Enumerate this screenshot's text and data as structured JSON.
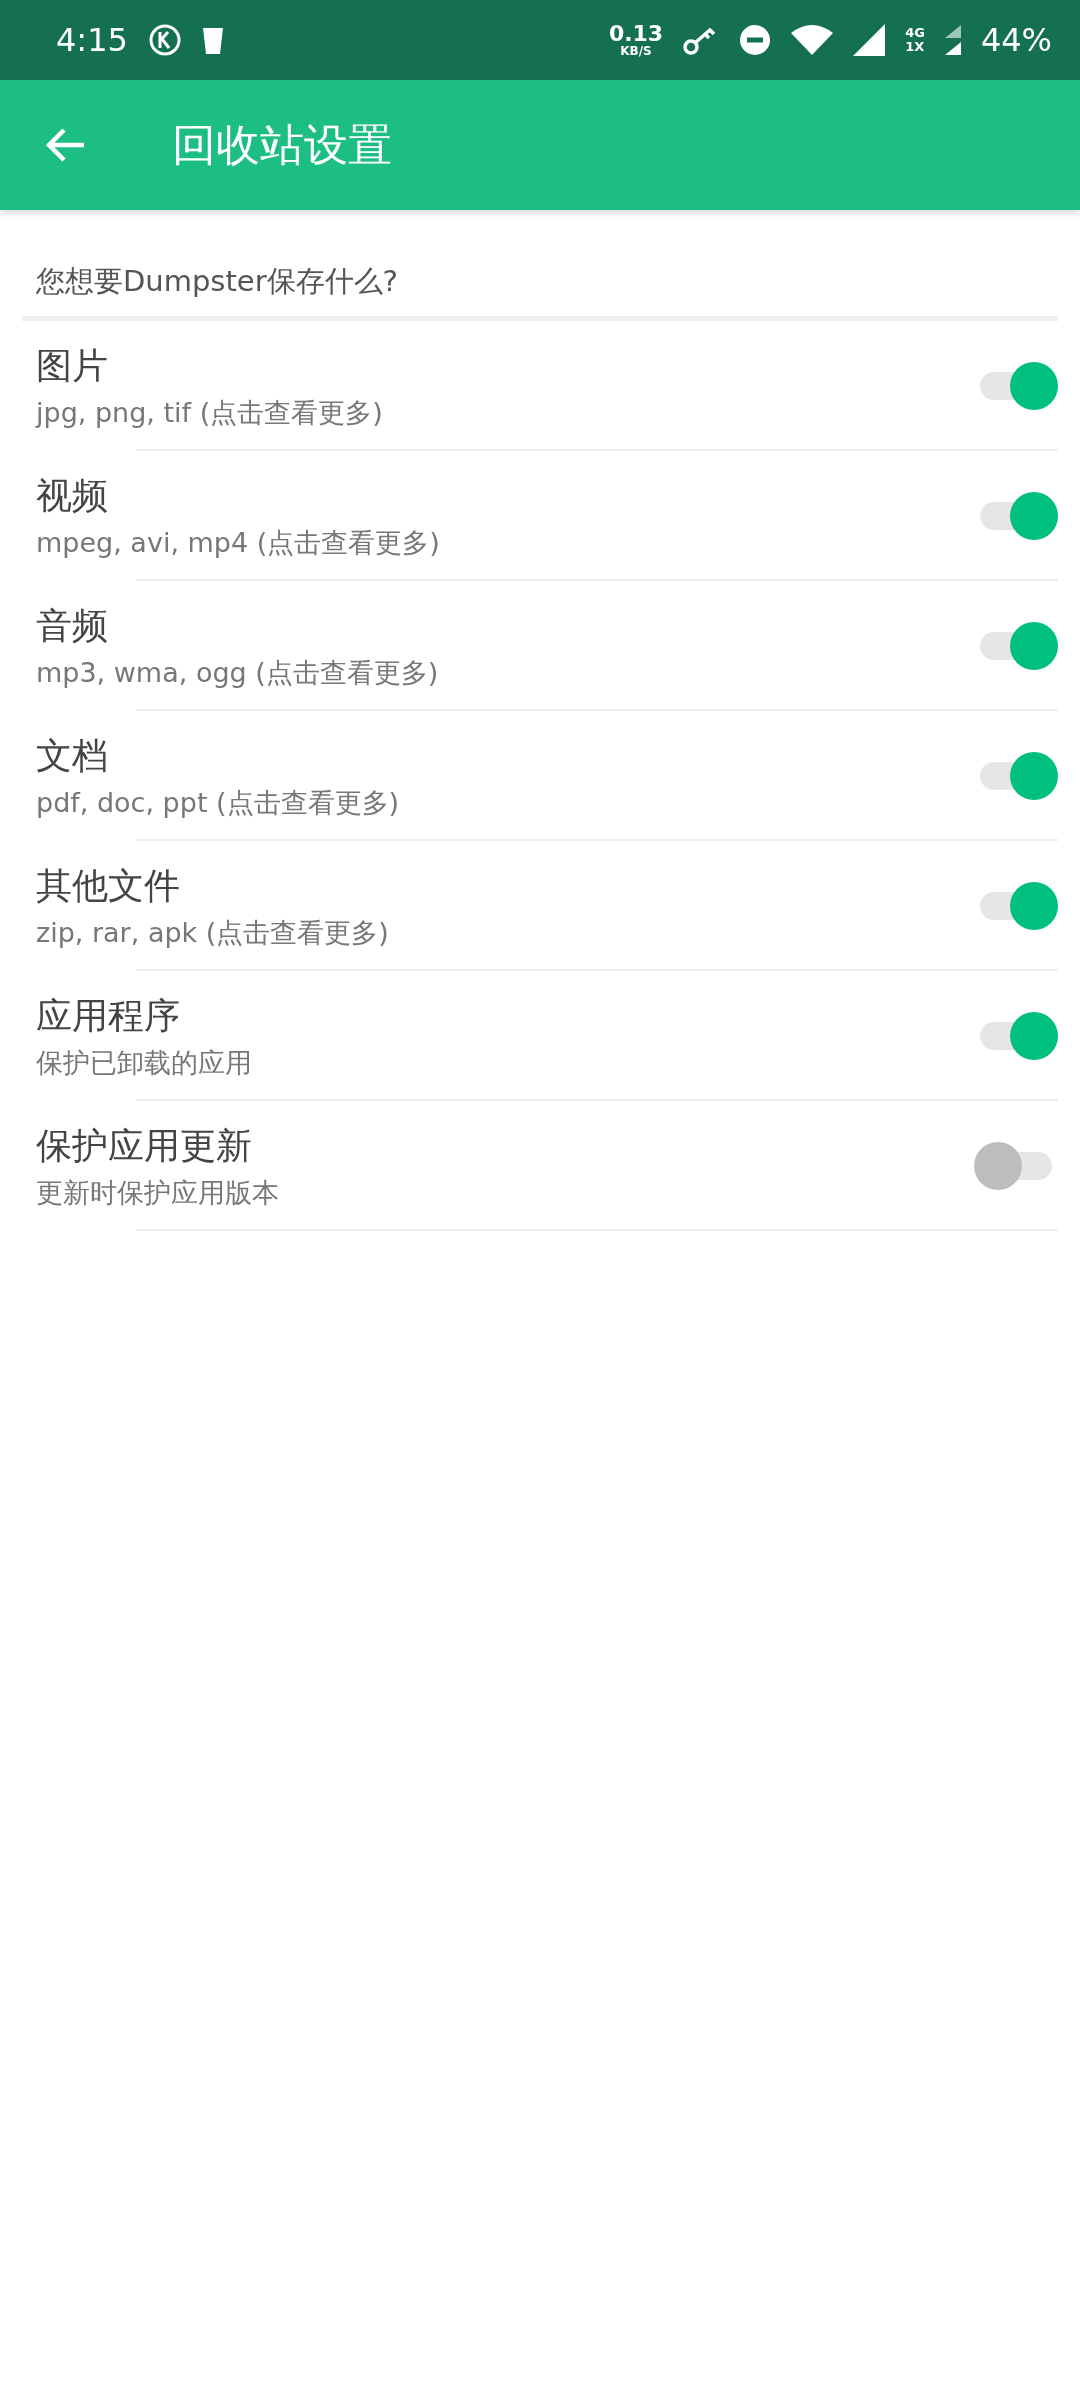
{
  "status_bar": {
    "time": "4:15",
    "speed_value": "0.13",
    "speed_unit": "KB/S",
    "network_top": "4G",
    "network_bottom": "1X",
    "battery": "44%"
  },
  "app_bar": {
    "title": "回收站设置"
  },
  "section": {
    "title": "您想要Dumpster保存什么?"
  },
  "settings": [
    {
      "title": "图片",
      "summary": "jpg, png, tif (点击查看更多)",
      "on": true
    },
    {
      "title": "视频",
      "summary": "mpeg, avi, mp4 (点击查看更多)",
      "on": true
    },
    {
      "title": "音频",
      "summary": "mp3, wma, ogg (点击查看更多)",
      "on": true
    },
    {
      "title": "文档",
      "summary": "pdf, doc, ppt (点击查看更多)",
      "on": true
    },
    {
      "title": "其他文件",
      "summary": "zip, rar, apk (点击查看更多)",
      "on": true
    },
    {
      "title": "应用程序",
      "summary": "保护已卸载的应用",
      "on": true
    },
    {
      "title": "保护应用更新",
      "summary": "更新时保护应用版本",
      "on": false
    }
  ]
}
